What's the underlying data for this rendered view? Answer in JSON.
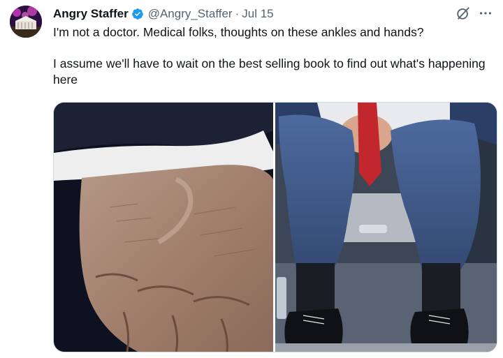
{
  "tweet": {
    "author_name": "Angry Staffer",
    "handle": "@Angry_Staffer",
    "separator": "·",
    "date": "Jul 15",
    "text_line1": "I'm not a doctor. Medical folks, thoughts on these ankles and hands?",
    "text_line2": "I assume we'll have to wait on the best selling book to find out what's happening here"
  },
  "icons": {
    "verified": "verified-badge-icon",
    "grok": "grok-icon",
    "more": "more-icon"
  },
  "colors": {
    "verified_blue": "#1d9bf0",
    "muted_text": "#536471"
  }
}
